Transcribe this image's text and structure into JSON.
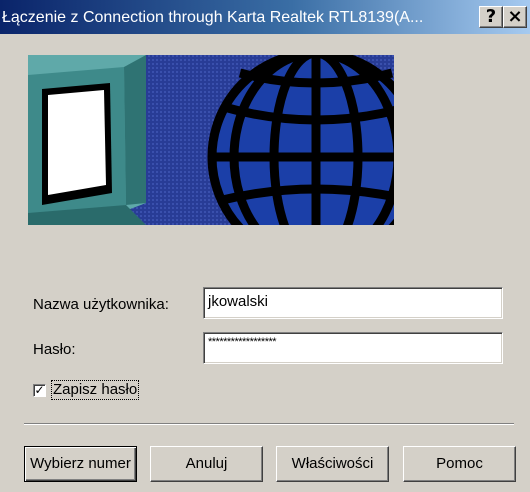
{
  "window": {
    "title": "Łączenie z Connection through Karta Realtek RTL8139(A...",
    "help_glyph": "?",
    "close_glyph": "×"
  },
  "banner": {
    "icon": "network-banner-image"
  },
  "form": {
    "username_label": "Nazwa użytkownika:",
    "username_value": "jkowalski",
    "password_label": "Hasło:",
    "password_value": "******************",
    "save_password_label": "Zapisz hasło",
    "save_password_checked": true,
    "check_glyph": "✓"
  },
  "buttons": {
    "dial": "Wybierz numer",
    "cancel": "Anuluj",
    "properties": "Właściwości",
    "help": "Pomoc"
  },
  "colors": {
    "title_start": "#0a246a",
    "title_end": "#a6caf0",
    "face": "#d4d0c8",
    "banner_blue": "#2a3f9a",
    "monitor_teal": "#5fa9a9"
  }
}
